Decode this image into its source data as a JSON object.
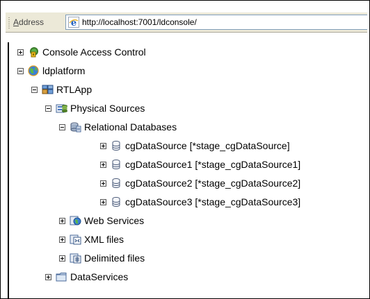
{
  "address_bar": {
    "label": "Address",
    "url": "http://localhost:7001/ldconsole/"
  },
  "tree": {
    "console_access_control": "Console Access Control",
    "ldplatform": "ldplatform",
    "rtlapp": "RTLApp",
    "physical_sources": "Physical Sources",
    "relational_databases": "Relational Databases",
    "datasources": [
      "cgDataSource [*stage_cgDataSource]",
      "cgDataSource1 [*stage_cgDataSource1]",
      "cgDataSource2 [*stage_cgDataSource2]",
      "cgDataSource3 [*stage_cgDataSource3]"
    ],
    "web_services": "Web Services",
    "xml_files": "XML files",
    "delimited_files": "Delimited files",
    "data_services": "DataServices"
  },
  "icons": {
    "ie": "internet-explorer-icon",
    "console_access_control": "key-icon",
    "ldplatform": "globe-icon",
    "rtlapp": "application-icon",
    "physical_sources": "physical-sources-icon",
    "relational_databases": "relational-databases-icon",
    "datasource": "database-cylinder-icon",
    "web_services": "web-services-icon",
    "xml_files": "xml-files-icon",
    "delimited_files": "delimited-files-icon",
    "data_services": "folder-icon"
  }
}
